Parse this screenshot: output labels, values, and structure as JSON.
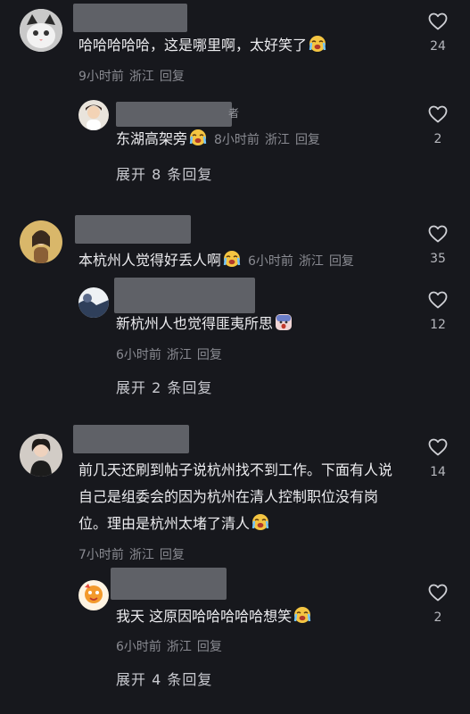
{
  "comments": [
    {
      "text": "哈哈哈哈哈，这是哪里啊，太好笑了",
      "time": "9小时前",
      "location": "浙江",
      "reply_label": "回复",
      "likes": "24",
      "reply": {
        "text": "东湖高架旁",
        "time": "8小时前",
        "location": "浙江",
        "reply_label": "回复",
        "likes": "2",
        "author_tag": "者"
      },
      "expand": "展开 8 条回复"
    },
    {
      "text": "本杭州人觉得好丢人啊",
      "time": "6小时前",
      "location": "浙江",
      "reply_label": "回复",
      "likes": "35",
      "reply": {
        "text": "新杭州人也觉得匪夷所思",
        "time": "6小时前",
        "location": "浙江",
        "reply_label": "回复",
        "likes": "12"
      },
      "expand": "展开 2 条回复"
    },
    {
      "text": "前几天还刷到帖子说杭州找不到工作。下面有人说自己是组委会的因为杭州在清人控制职位没有岗位。理由是杭州太堵了清人",
      "time": "7小时前",
      "location": "浙江",
      "reply_label": "回复",
      "likes": "14",
      "reply": {
        "text": "我天 这原因哈哈哈哈哈想笑",
        "time": "6小时前",
        "location": "浙江",
        "reply_label": "回复",
        "likes": "2"
      },
      "expand": "展开 4 条回复"
    }
  ],
  "colors": {
    "background": "#17181d",
    "meta": "#8a8b92",
    "text": "#ececef"
  }
}
